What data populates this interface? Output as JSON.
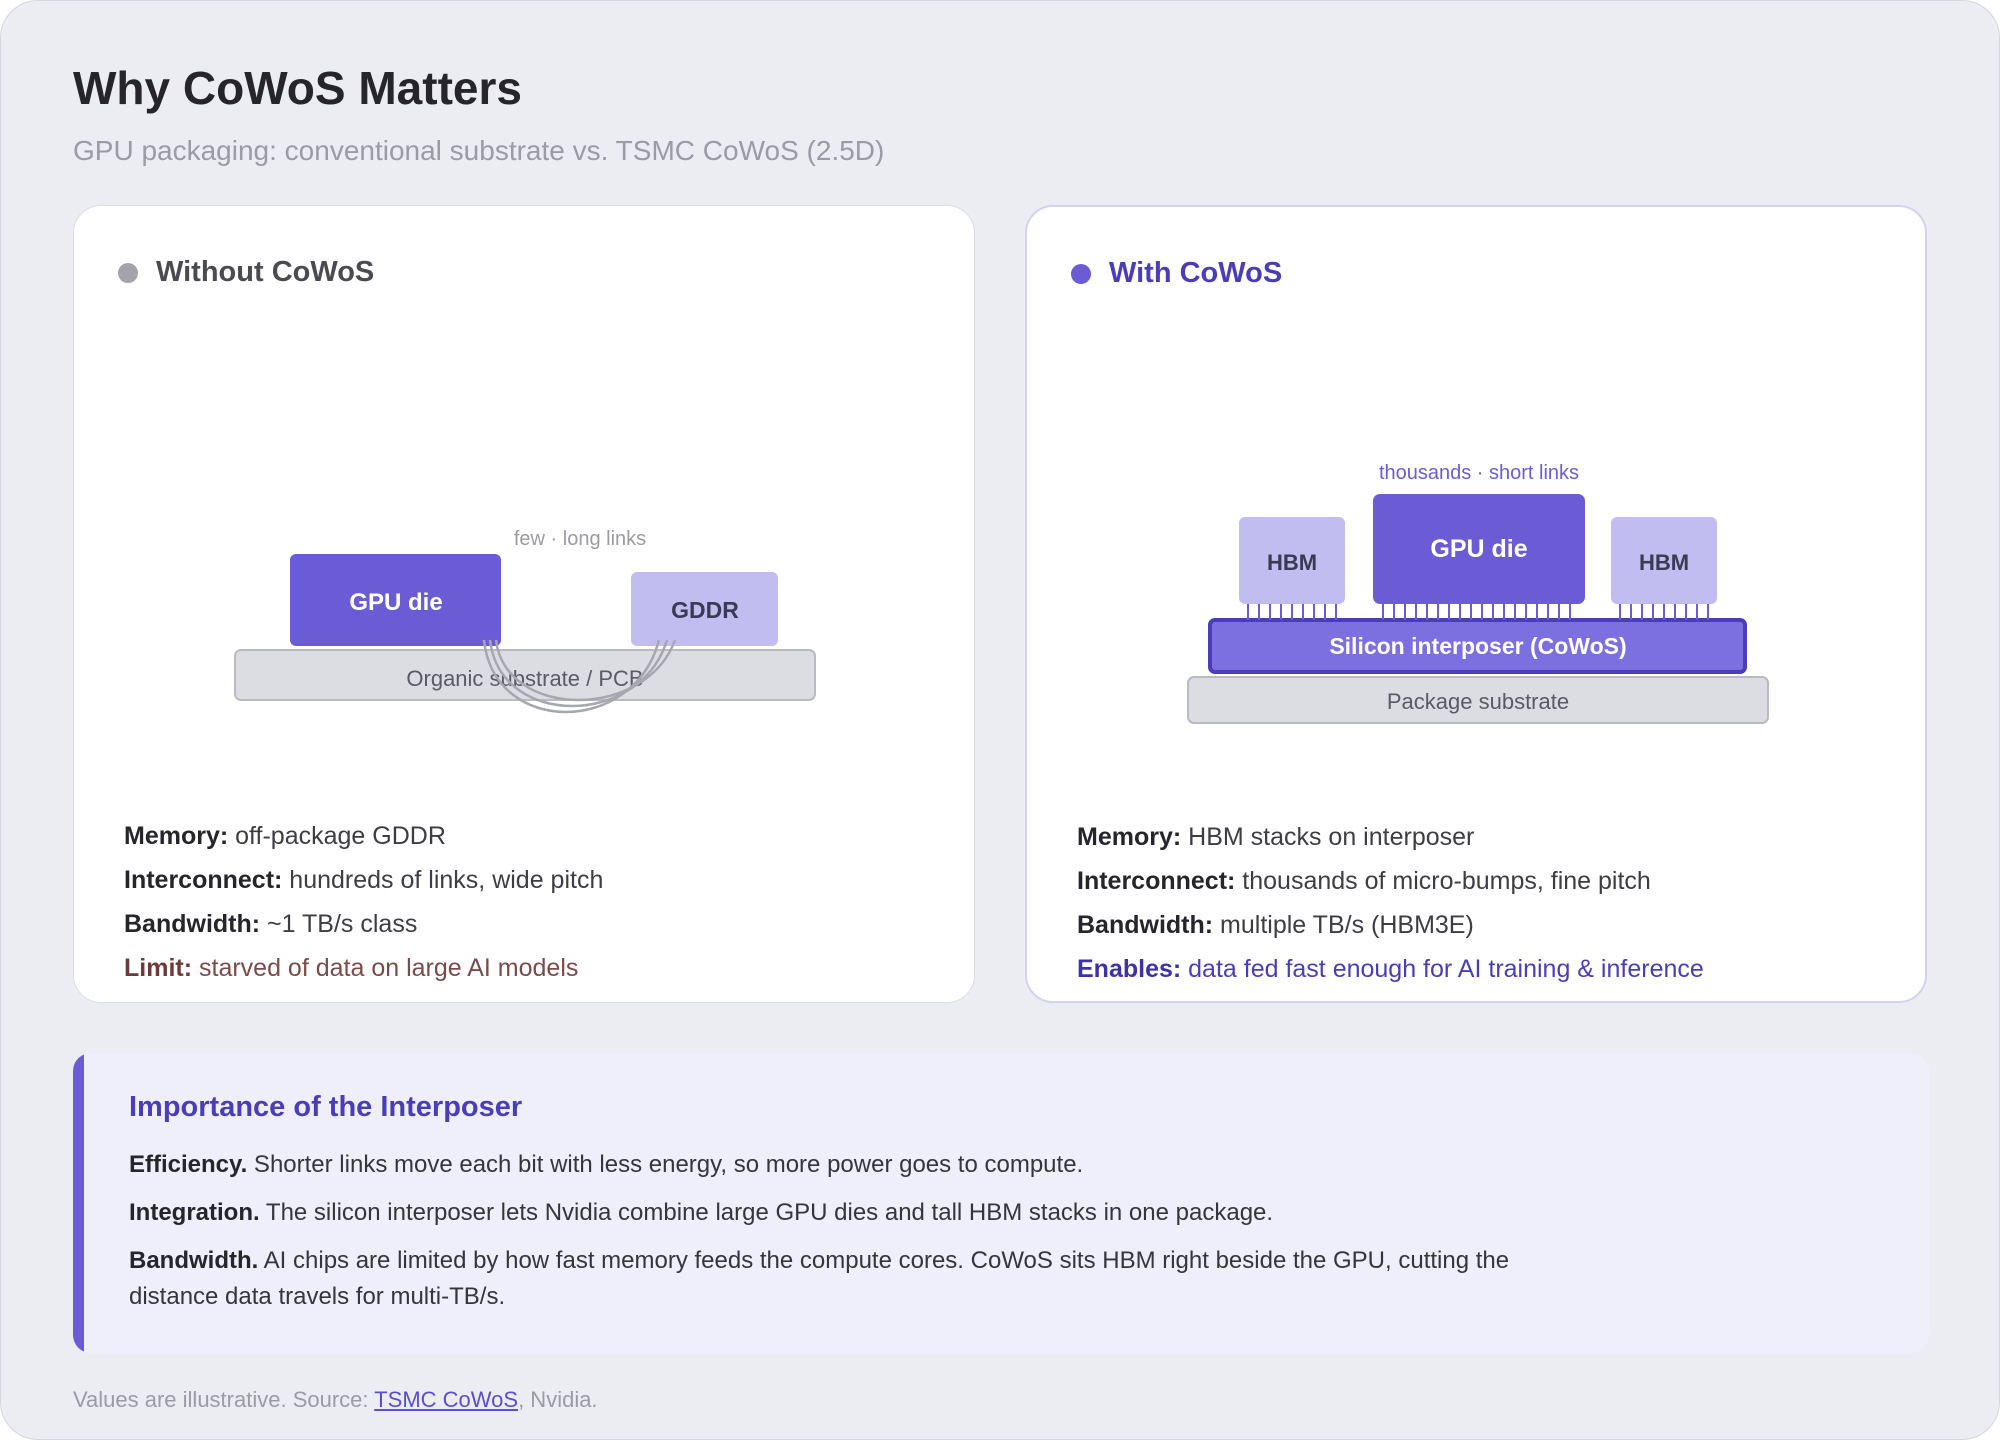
{
  "title": "Why CoWoS Matters",
  "subtitle": "GPU packaging: conventional substrate vs. TSMC CoWoS (2.5D)",
  "left_panel": {
    "heading": "Without CoWoS",
    "diagram": {
      "gpu_label": "GPU die",
      "memory_label": "GDDR",
      "substrate_label": "Organic substrate / PCB",
      "links_label": "few · long links"
    },
    "facts": [
      {
        "key": "Memory:",
        "value": " off-package GDDR"
      },
      {
        "key": "Interconnect:",
        "value": " hundreds of links, wide pitch"
      },
      {
        "key": "Bandwidth:",
        "value": " ~1 TB/s class"
      },
      {
        "key": "Limit:",
        "value": " starved of data on large AI models"
      }
    ]
  },
  "right_panel": {
    "heading": "With CoWoS",
    "diagram": {
      "gpu_label": "GPU die",
      "hbm_left_label": "HBM",
      "hbm_right_label": "HBM",
      "interposer_label": "Silicon interposer (CoWoS)",
      "substrate_label": "Package substrate",
      "links_label": "thousands · short links"
    },
    "facts": [
      {
        "key": "Memory:",
        "value": " HBM stacks on interposer"
      },
      {
        "key": "Interconnect:",
        "value": " thousands of micro-bumps, fine pitch"
      },
      {
        "key": "Bandwidth:",
        "value": " multiple TB/s (HBM3E)"
      },
      {
        "key": "Enables:",
        "value": " data fed fast enough for AI training & inference"
      }
    ]
  },
  "callout": {
    "title": "Importance of the Interposer",
    "points": [
      {
        "key": "Efficiency.",
        "text": " Shorter links move each bit with less energy, so more power goes to compute."
      },
      {
        "key": "Integration.",
        "text": " The silicon interposer lets Nvidia combine large GPU dies and tall HBM stacks in one package."
      },
      {
        "key": "Bandwidth.",
        "text": " AI chips are limited by how fast memory feeds the compute cores. CoWoS sits HBM right beside the GPU, cutting the distance data travels for multi-TB/s."
      }
    ]
  },
  "footer": {
    "prefix": "Values are illustrative. Source: ",
    "link_text": "TSMC CoWoS",
    "suffix": ", Nvidia."
  },
  "colors": {
    "accent": "#6b5cd6",
    "accent_dark": "#4a3db8",
    "memory_light": "#c2bdf1",
    "substrate": "#dcdde2"
  }
}
